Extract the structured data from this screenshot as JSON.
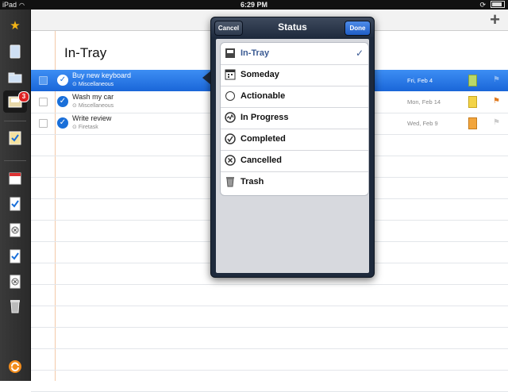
{
  "status_bar": {
    "carrier": "iPad",
    "time": "6:29 PM"
  },
  "sidebar": {
    "items": [
      {
        "icon": "star-icon"
      },
      {
        "icon": "notebook-icon"
      },
      {
        "icon": "folder-icon"
      },
      {
        "icon": "in-tray-icon",
        "badge": "3"
      },
      {
        "icon": "document-check-icon"
      },
      {
        "icon": "calendar-icon"
      },
      {
        "icon": "checkbox-notebook-icon"
      },
      {
        "icon": "cancelled-notebook-icon"
      },
      {
        "icon": "checkbox-notebook-icon"
      },
      {
        "icon": "cancelled-notebook-icon"
      },
      {
        "icon": "trash-icon"
      },
      {
        "icon": "sync-icon"
      }
    ]
  },
  "page": {
    "title": "In-Tray"
  },
  "tasks": [
    {
      "name": "Buy new keyboard",
      "project": "Miscellaneous",
      "date": "Fri, Feb 4",
      "note_color": "green",
      "flagged": false,
      "selected": true
    },
    {
      "name": "Wash my car",
      "project": "Miscellaneous",
      "date": "Mon, Feb 14",
      "note_color": "yellow",
      "flagged": true,
      "selected": false
    },
    {
      "name": "Write review",
      "project": "Firetask",
      "date": "Wed, Feb 9",
      "note_color": "orange",
      "flagged": false,
      "selected": false
    }
  ],
  "popover": {
    "title": "Status",
    "cancel_label": "Cancel",
    "done_label": "Done",
    "options": [
      {
        "label": "In-Tray",
        "icon": "in-tray-icon",
        "checked": true
      },
      {
        "label": "Someday",
        "icon": "calendar-icon",
        "checked": false
      },
      {
        "label": "Actionable",
        "icon": "empty-circle-icon",
        "checked": false
      },
      {
        "label": "In Progress",
        "icon": "in-progress-icon",
        "checked": false
      },
      {
        "label": "Completed",
        "icon": "check-circle-icon",
        "checked": false
      },
      {
        "label": "Cancelled",
        "icon": "x-circle-icon",
        "checked": false
      },
      {
        "label": "Trash",
        "icon": "trash-icon",
        "checked": false
      }
    ],
    "check_mark": "✓"
  },
  "colors": {
    "selection_blue": "#1a66d8",
    "done_blue": "#1f5dc6",
    "checked_label": "#3a5a93"
  }
}
